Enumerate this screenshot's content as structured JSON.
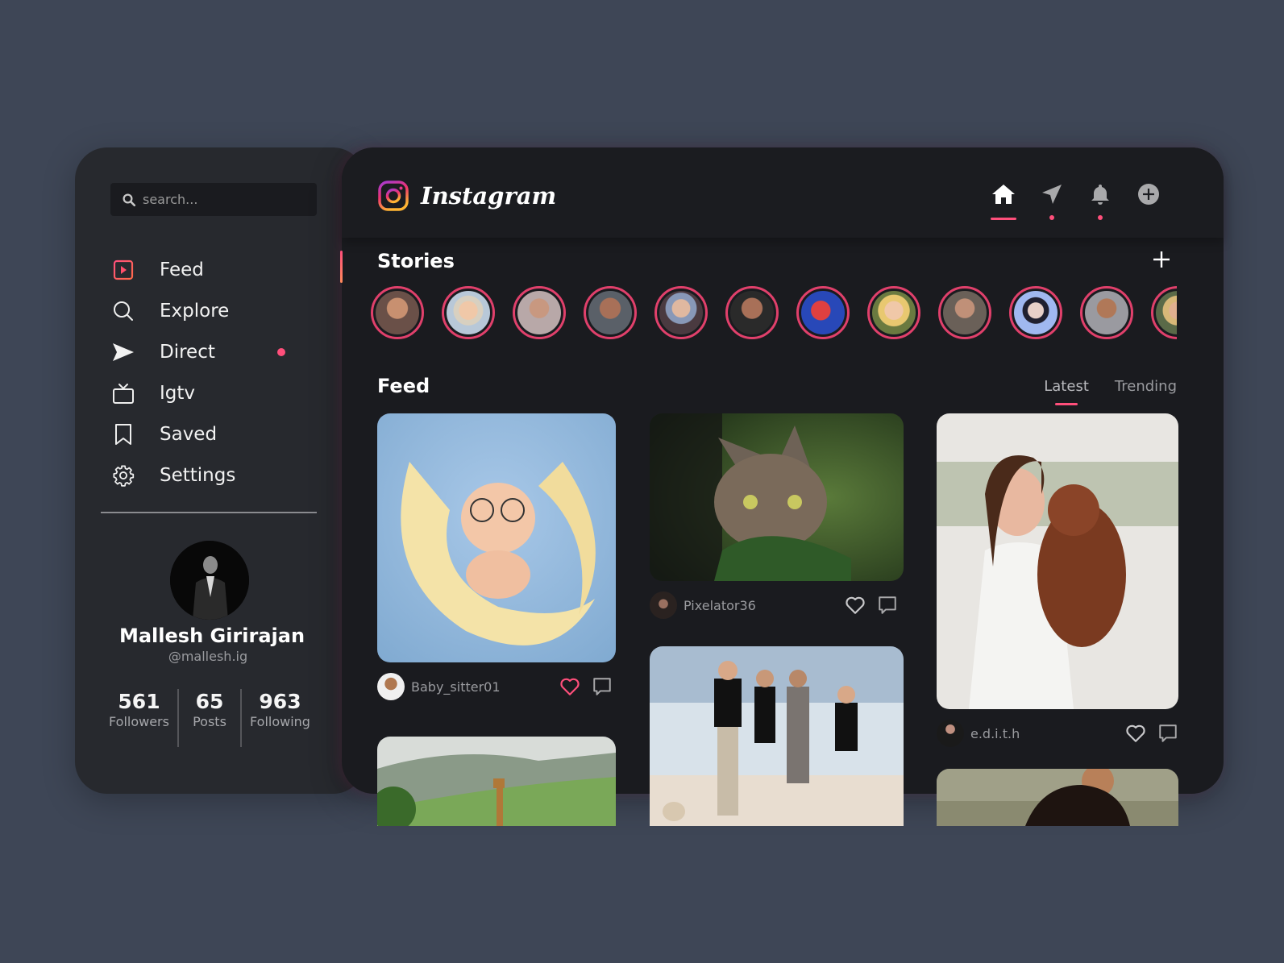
{
  "sidebar": {
    "search": {
      "placeholder": "search...",
      "value": ""
    },
    "nav": [
      {
        "label": "Feed",
        "icon": "play-square-icon",
        "active": true
      },
      {
        "label": "Explore",
        "icon": "search-icon"
      },
      {
        "label": "Direct",
        "icon": "send-icon",
        "badge": true
      },
      {
        "label": "Igtv",
        "icon": "tv-icon"
      },
      {
        "label": "Saved",
        "icon": "bookmark-icon"
      },
      {
        "label": "Settings",
        "icon": "gear-icon"
      }
    ],
    "profile": {
      "name": "Mallesh Girirajan",
      "handle": "@mallesh.ig",
      "stats": [
        {
          "value": "561",
          "label": "Followers"
        },
        {
          "value": "65",
          "label": "Posts"
        },
        {
          "value": "963",
          "label": "Following"
        }
      ]
    }
  },
  "header": {
    "app_name": "Instagram",
    "icons": [
      "home-icon",
      "send-icon",
      "bell-icon",
      "add-circle-icon"
    ]
  },
  "stories": {
    "title": "Stories",
    "count_visible": 12
  },
  "feed": {
    "title": "Feed",
    "tabs": [
      {
        "label": "Latest",
        "active": true
      },
      {
        "label": "Trending",
        "active": false
      }
    ],
    "posts": [
      {
        "username": "Baby_sitter01",
        "liked": true,
        "image": "baby-on-pillow"
      },
      {
        "username": "Pixelator36",
        "liked": false,
        "image": "cat-in-leaves"
      },
      {
        "username": "e.d.i.t.h",
        "liked": false,
        "image": "woman-with-poodle"
      },
      {
        "image": "giraffe-landscape"
      },
      {
        "image": "family-on-beach"
      },
      {
        "image": "woman-portrait"
      }
    ]
  },
  "colors": {
    "accent": "#ff4f7b",
    "background": "#3e4656",
    "sidebar_bg": "#27292e",
    "main_bg": "#1a1b1f"
  }
}
